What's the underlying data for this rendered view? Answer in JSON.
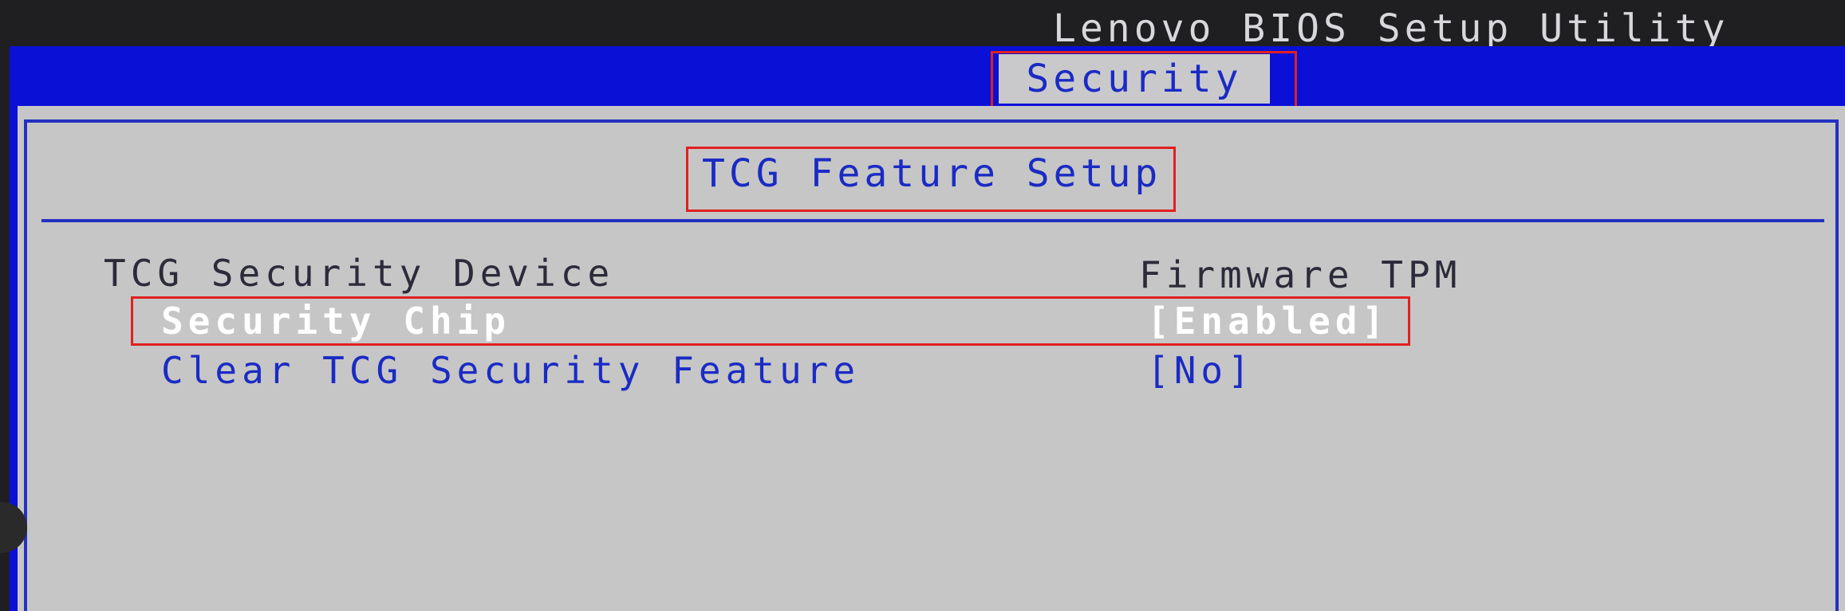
{
  "window": {
    "title": "Lenovo BIOS Setup Utility"
  },
  "tabs": [
    {
      "label": "Security",
      "active": true
    }
  ],
  "section": {
    "heading": "TCG Feature Setup"
  },
  "settings": [
    {
      "label": "TCG Security Device",
      "value": "Firmware TPM",
      "style": "static"
    },
    {
      "label": "Security Chip",
      "value": "[Enabled]",
      "style": "selected"
    },
    {
      "label": "Clear TCG Security Feature",
      "value": "[No]",
      "style": "option"
    }
  ],
  "colors": {
    "background": "#1f1f22",
    "blue_bar": "#0a10d6",
    "panel": "#c6c6c6",
    "text_blue": "#1a2bc4",
    "highlight_box": "#e02020",
    "selected_text": "#ffffff"
  }
}
